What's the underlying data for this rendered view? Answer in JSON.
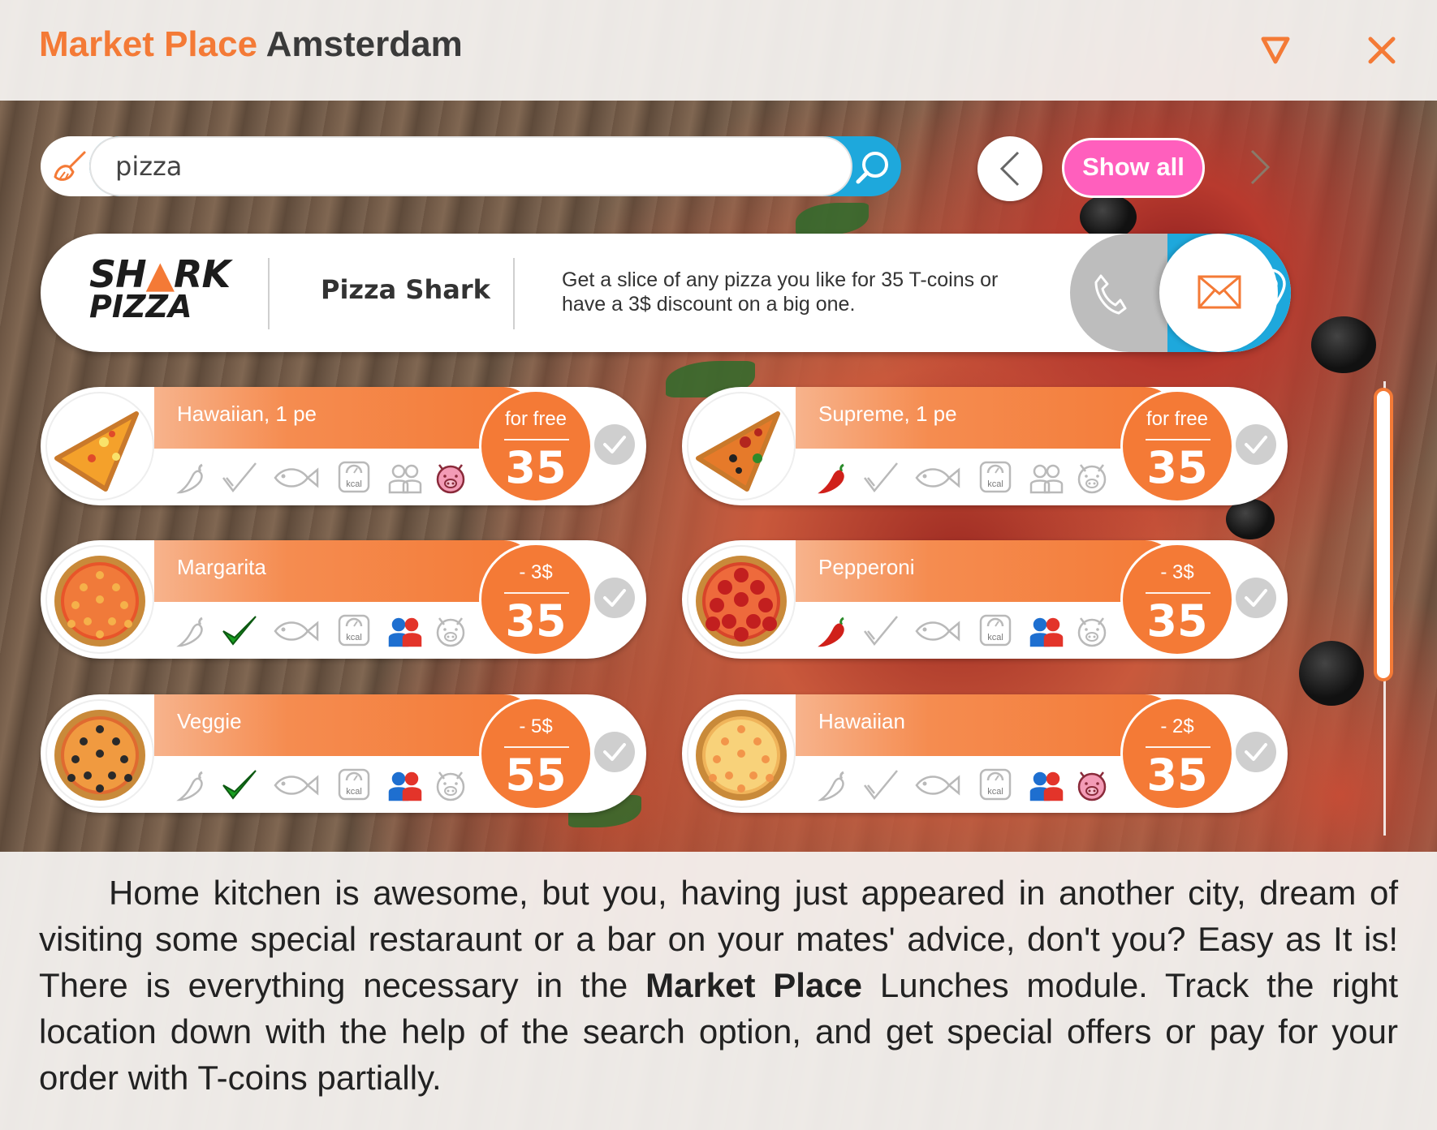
{
  "header": {
    "title_part1": "Market Place",
    "title_part2": "Amsterdam"
  },
  "search": {
    "value": "pizza",
    "show_all_label": "Show all"
  },
  "vendor": {
    "logo_line1_left": "SH",
    "logo_line1_right": "RK",
    "logo_line2": "PIZZA",
    "name": "Pizza Shark",
    "description": "Get a slice of any pizza you like for 35 T-coins or have a 3$ discount on a big one."
  },
  "products": [
    {
      "name": "Hawaiian, 1 pe",
      "price_label": "for free",
      "price": "35",
      "spicy": false,
      "vegetarian": false,
      "sharing": false,
      "pork": true
    },
    {
      "name": "Supreme, 1 pe",
      "price_label": "for free",
      "price": "35",
      "spicy": true,
      "vegetarian": false,
      "sharing": false,
      "pork": false
    },
    {
      "name": "Margarita",
      "price_label": "- 3$",
      "price": "35",
      "spicy": false,
      "vegetarian": true,
      "sharing": true,
      "pork": false
    },
    {
      "name": "Pepperoni",
      "price_label": "- 3$",
      "price": "35",
      "spicy": true,
      "vegetarian": false,
      "sharing": true,
      "pork": false
    },
    {
      "name": "Veggie",
      "price_label": "- 5$",
      "price": "55",
      "spicy": false,
      "vegetarian": true,
      "sharing": true,
      "pork": false
    },
    {
      "name": "Hawaiian",
      "price_label": "- 2$",
      "price": "35",
      "spicy": false,
      "vegetarian": false,
      "sharing": true,
      "pork": true
    }
  ],
  "icon_kcal_label": "kcal",
  "description": {
    "part1": "Home kitchen is awesome, but you, having just appeared in another city, dream of visiting some special restaraunt or a bar on your mates' advice, don't you? Easy as It is! There is everything necessary in the ",
    "bold": "Market Place",
    "part2": " Lunches module. Track the right location down with the help of the search option, and get special offers or pay for your order with T-coins partially."
  },
  "colors": {
    "accent": "#f47a36",
    "blue": "#1ea8dc",
    "pink": "#ff5fbd"
  }
}
